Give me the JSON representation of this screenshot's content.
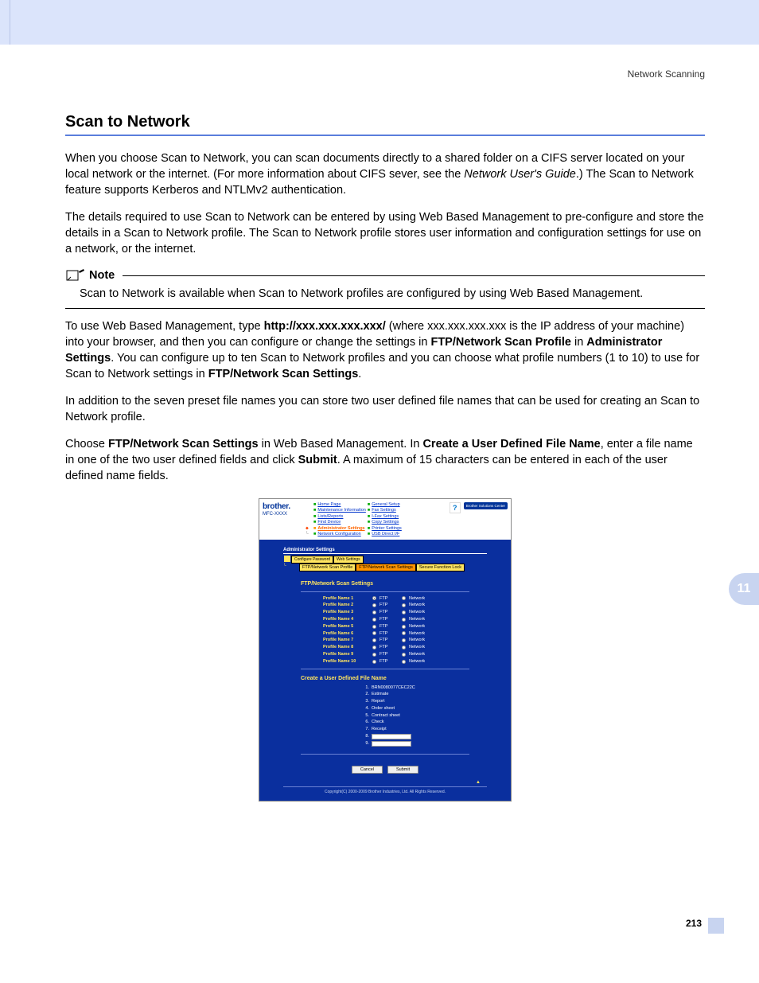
{
  "header_label": "Network Scanning",
  "chapter_number": "11",
  "page_number": "213",
  "h1": "Scan to Network",
  "p1_a": "When you choose Scan to Network, you can scan documents directly to a shared folder on a CIFS server located on your local network or the internet. (For more information about CIFS sever, see the ",
  "p1_italic": "Network User's Guide",
  "p1_b": ".) The Scan to Network feature supports Kerberos and NTLMv2 authentication.",
  "p2": "The details required to use Scan to Network can be entered by using Web Based Management to pre-configure and store the details in a Scan to Network profile. The Scan to Network profile stores user information and configuration settings for use on a network, or the internet.",
  "note_title": "Note",
  "note_body": "Scan to Network is available when Scan to Network profiles are configured by using Web Based Management.",
  "p3_a": "To use Web Based Management, type ",
  "p3_bold_url": "http://xxx.xxx.xxx.xxx/",
  "p3_b": " (where xxx.xxx.xxx.xxx is the IP address of your machine) into your browser, and then you can configure or change the settings in ",
  "p3_bold_1": "FTP/Network Scan Profile",
  "p3_c": " in ",
  "p3_bold_2": "Administrator Settings",
  "p3_d": ". You can configure up to ten Scan to Network profiles and you can choose what profile numbers (1 to 10) to use for Scan to Network settings in ",
  "p3_bold_3": "FTP/Network Scan Settings",
  "p3_e": ".",
  "p4": "In addition to the seven preset file names you can store two user defined file names that can be used for creating an Scan to Network profile.",
  "p5_a": "Choose ",
  "p5_bold_1": "FTP/Network Scan Settings",
  "p5_b": " in Web Based Management. In ",
  "p5_bold_2": "Create a User Defined File Name",
  "p5_c": ", enter a file name in one of the two user defined fields and click ",
  "p5_bold_3": "Submit",
  "p5_d": ". A maximum of 15 characters can be entered in each of the user defined name fields.",
  "screenshot": {
    "brand_logo": "brother.",
    "brand_model": "MFC-XXXX",
    "nav_col1": [
      "Home Page",
      "Maintenance Information",
      "Lists/Reports",
      "Find Device",
      "Administrator Settings",
      "Network Configuration"
    ],
    "nav_col2": [
      "General Setup",
      "Fax Settings",
      "I-Fax Settings",
      "Copy Settings",
      "Printer Settings",
      "USB Direct I/F"
    ],
    "help_button": "Brother Solutions Center",
    "admin_title": "Administrator Settings",
    "top_tabs": [
      "Configure Password",
      "Web Settings"
    ],
    "sub_tabs": [
      "FTP/Network Scan Profile",
      "FTP/Network Scan Settings",
      "Secure Function Lock"
    ],
    "section_title": "FTP/Network Scan Settings",
    "profile_label_prefix": "Profile Name ",
    "radio_ftp": "FTP",
    "radio_network": "Network",
    "profiles": [
      1,
      2,
      3,
      4,
      5,
      6,
      7,
      8,
      9,
      10
    ],
    "profile_checked_ftp": 1,
    "section_title_2": "Create a User Defined File Name",
    "filenames": [
      "BRN0080077CEC22C",
      "Estimate",
      "Report",
      "Order sheet",
      "Contract sheet",
      "Check",
      "Receipt"
    ],
    "input_rows": [
      "8.",
      "9."
    ],
    "btn_cancel": "Cancel",
    "btn_submit": "Submit",
    "scroll_top": "▲",
    "footer": "Copyright(C) 2000-2009 Brother Industries, Ltd. All Rights Reserved."
  }
}
